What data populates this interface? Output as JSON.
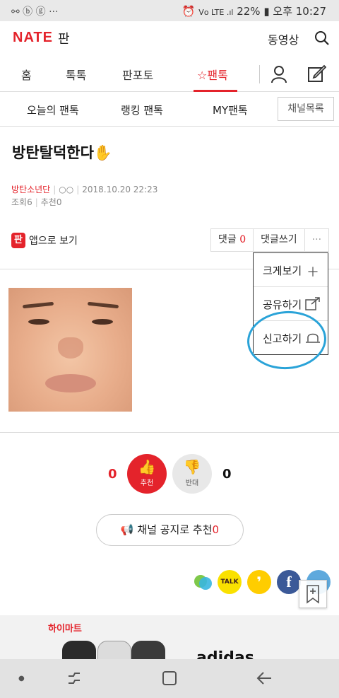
{
  "status_bar": {
    "carrier_icons": "⚯ ⓑ ⓖ ···",
    "signal": "Vᴏ LTE .ıl",
    "battery": "22%",
    "time": "오후 10:27"
  },
  "header": {
    "logo": "NATE",
    "logo_sub": "판",
    "video": "동영상"
  },
  "tabs": {
    "items": [
      "홈",
      "톡톡",
      "판포토",
      "☆팬톡"
    ]
  },
  "subtabs": {
    "items": [
      "오늘의 팬톡",
      "랭킹 팬톡",
      "MY팬톡"
    ],
    "channel_list": "채널목록"
  },
  "post": {
    "title": "방탄탈덕한다✋",
    "author": "방탄소년단",
    "author_id": "○○",
    "date": "2018.10.20 22:23",
    "views": "조회6",
    "recommends": "추천0"
  },
  "actions": {
    "app_badge": "판",
    "app_view": "앱으로 보기",
    "comment": "댓글",
    "comment_count": "0",
    "write_comment": "댓글쓰기",
    "more": "···"
  },
  "dropdown": {
    "zoom": "크게보기",
    "share": "공유하기",
    "report": "신고하기"
  },
  "votes": {
    "up_count": "0",
    "up_label": "추천",
    "down_label": "반대",
    "down_count": "0"
  },
  "notice": {
    "label": "채널 공지로 추천",
    "count": "0"
  },
  "share_icons": {
    "kakao_talk": "TALK",
    "kakao_story": "❜",
    "facebook": "f"
  },
  "ad": {
    "store": "하이마트",
    "brand": "adidas"
  },
  "colors": {
    "accent": "#e4232b",
    "annotation": "#2aa3d8"
  }
}
